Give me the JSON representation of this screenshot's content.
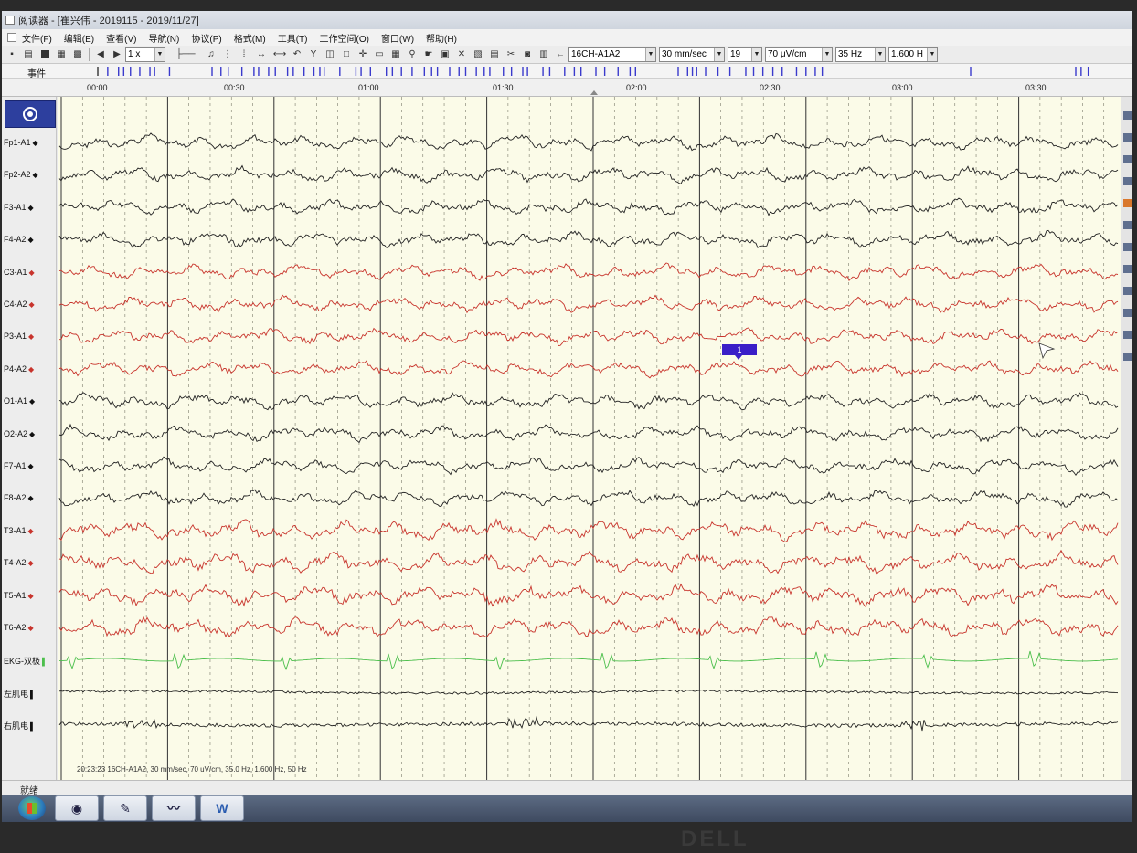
{
  "window": {
    "title": "阅读器 - [崔兴伟 - 2019115 - 2019/11/27]"
  },
  "menu": {
    "items": [
      "文件(F)",
      "编辑(E)",
      "查看(V)",
      "导航(N)",
      "协议(P)",
      "格式(M)",
      "工具(T)",
      "工作空间(O)",
      "窗口(W)",
      "帮助(H)"
    ]
  },
  "toolbar": {
    "speed": "1 x",
    "montage": "16CH-A1A2",
    "paper_speed": "30 mm/sec",
    "channel_count": "19",
    "sensitivity": "70 μV/cm",
    "high_filter": "35 Hz",
    "low_filter": "1.600 H"
  },
  "events": {
    "label": "事件"
  },
  "timeline": {
    "labels": [
      "00:00",
      "00:30",
      "01:00",
      "01:30",
      "02:00",
      "02:30",
      "03:00",
      "03:30"
    ]
  },
  "channels": [
    {
      "label": "Fp1-A1",
      "color": "#222222",
      "dot": "◆"
    },
    {
      "label": "Fp2-A2",
      "color": "#222222",
      "dot": "◆"
    },
    {
      "label": "F3-A1",
      "color": "#222222",
      "dot": "◆"
    },
    {
      "label": "F4-A2",
      "color": "#222222",
      "dot": "◆"
    },
    {
      "label": "C3-A1",
      "color": "#c8342c",
      "dot": "◆"
    },
    {
      "label": "C4-A2",
      "color": "#c8342c",
      "dot": "◆"
    },
    {
      "label": "P3-A1",
      "color": "#c8342c",
      "dot": "◆"
    },
    {
      "label": "P4-A2",
      "color": "#c8342c",
      "dot": "◆"
    },
    {
      "label": "O1-A1",
      "color": "#222222",
      "dot": "◆"
    },
    {
      "label": "O2-A2",
      "color": "#222222",
      "dot": "◆"
    },
    {
      "label": "F7-A1",
      "color": "#222222",
      "dot": "◆"
    },
    {
      "label": "F8-A2",
      "color": "#222222",
      "dot": "◆"
    },
    {
      "label": "T3-A1",
      "color": "#c8342c",
      "dot": "◆"
    },
    {
      "label": "T4-A2",
      "color": "#c8342c",
      "dot": "◆"
    },
    {
      "label": "T5-A1",
      "color": "#c8342c",
      "dot": "◆"
    },
    {
      "label": "T6-A2",
      "color": "#c8342c",
      "dot": "◆"
    },
    {
      "label": "EKG-双极",
      "color": "#4cbf4c",
      "dot": "▌"
    },
    {
      "label": "左肌电",
      "color": "#111111",
      "dot": "▌"
    },
    {
      "label": "右肌电",
      "color": "#111111",
      "dot": "▌"
    }
  ],
  "marker": {
    "label": "1"
  },
  "status": {
    "info": "20:23:23 16CH-A1A2, 30 mm/sec, 70 uV/cm, 35.0 Hz, 1.600 Hz, 50 Hz",
    "ready": "就绪"
  },
  "taskbar": {
    "word_label": "W"
  },
  "monitor": {
    "brand": "DELL"
  },
  "colors": {
    "trace_background": "#fbfbe8",
    "event_tick": "#3a3acc",
    "marker": "#3a1ec8"
  }
}
